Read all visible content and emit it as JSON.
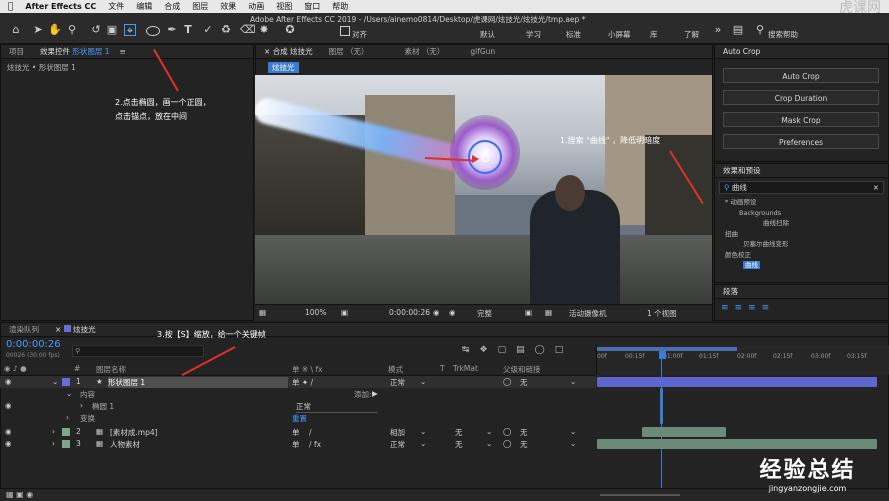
{
  "menubar": {
    "app": "After Effects CC",
    "items": [
      "文件",
      "编辑",
      "合成",
      "图层",
      "效果",
      "动画",
      "视图",
      "窗口",
      "帮助"
    ]
  },
  "window_title": "Adobe After Effects CC 2019 - /Users/ainemo0814/Desktop/虎课网/炫技光/炫技光/tmp.aep *",
  "watermark_top": "虎课网",
  "toolbar": {
    "align_label": "对齐",
    "workspaces": [
      "默认",
      "学习",
      "标准",
      "小屏幕",
      "库"
    ],
    "more_label": "了解",
    "search_help_placeholder": "搜索帮助"
  },
  "project_panel": {
    "tab_project": "项目",
    "tab_effects_controls": "效果控件",
    "tab_effects_layer": "形状图层 1",
    "breadcrumb": "炫技光 • 形状图层 1"
  },
  "comp_panel": {
    "tab_comp_prefix": "合成",
    "tab_comp_name": "炫技光",
    "tab_layer": "图层 （无）",
    "tab_footage": "素材 （无）",
    "tab_gifgun": "gifGun",
    "comp_label": "炫技光"
  },
  "viewer_bar": {
    "zoom": "100%",
    "timecode": "0:00:00:26",
    "quality": "完整",
    "camera": "活动摄像机",
    "views": "1 个视图"
  },
  "right_panel": {
    "title": "Auto Crop",
    "buttons": [
      "Auto Crop",
      "Crop Duration",
      "Mask Crop",
      "Preferences"
    ],
    "effects_presets_title": "效果和预设",
    "search_value": "曲线",
    "tree": [
      {
        "label": "* 动画预设"
      },
      {
        "label": "Backgrounds"
      },
      {
        "label": "曲线扫除"
      },
      {
        "label": "扭曲"
      },
      {
        "label": "贝塞尔曲线变形"
      },
      {
        "label": "颜色校正"
      },
      {
        "label": "曲线"
      }
    ],
    "paragraph_title": "段落"
  },
  "annotations": {
    "step1": "1.搜索 \"曲线\" ，降低明暗度",
    "step2_line1": "2.点击椭圆，画一个正圆，",
    "step2_line2": "点击锚点，放在中间",
    "step3": "3.按【S】缩放，给一个关键帧"
  },
  "timeline": {
    "tab_render": "渲染队列",
    "tab_comp": "炫技光",
    "timecode": "0:00:00:26",
    "fps_info": "00026 (30.00 fps)",
    "search_placeholder": "",
    "col_num": "#",
    "col_layer_name": "图层名称",
    "col_switches": "单 ※ \\ fx",
    "col_mode": "模式",
    "col_t": "T",
    "col_trkmat": "TrkMat",
    "col_parent": "父级和链接",
    "ruler": [
      "00f",
      "00:15f",
      "01:00f",
      "01:15f",
      "02:00f",
      "02:15f",
      "03:00f",
      "03:15f"
    ],
    "layers": [
      {
        "num": "1",
        "name": "形状图层 1",
        "mode": "正常",
        "trkmat": "",
        "parent": "无",
        "color": "#6a6cd8"
      },
      {
        "num": "2",
        "name": "[素材成.mp4]",
        "mode": "相加",
        "trkmat": "无",
        "parent": "无",
        "color": "#7da58c"
      },
      {
        "num": "3",
        "name": "人物素材",
        "mode": "正常",
        "trkmat": "无",
        "parent": "无",
        "color": "#7da58c"
      }
    ],
    "content_label": "内容",
    "add_label": "添加:",
    "ellipse_label": "椭圆 1",
    "ellipse_mode": "正常",
    "transform_label": "变换",
    "reset_label": "重置"
  },
  "bottom_watermark": {
    "line1": "经验总结",
    "line2": "jingyanzongjie.com"
  },
  "colors": {
    "accent": "#4a9bff",
    "layer_bar": "#5e66d0",
    "footage_bar": "#6b8a78",
    "annotation_arrow": "#e0302a"
  }
}
